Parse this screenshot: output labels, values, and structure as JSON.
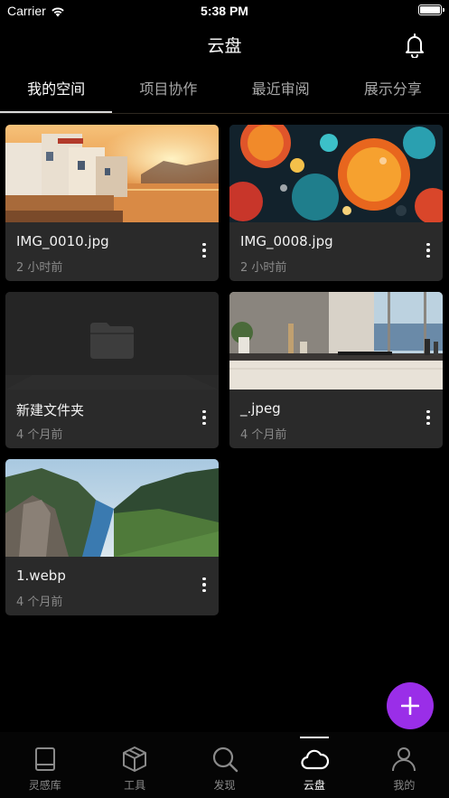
{
  "status_bar": {
    "carrier": "Carrier",
    "time": "5:38 PM",
    "battery_level": 1.0
  },
  "header": {
    "title": "云盘"
  },
  "tabs": [
    {
      "label": "我的空间",
      "active": true
    },
    {
      "label": "项目协作",
      "active": false
    },
    {
      "label": "最近审阅",
      "active": false
    },
    {
      "label": "展示分享",
      "active": false
    }
  ],
  "files": [
    {
      "name": "IMG_0010.jpg",
      "time": "2 小时前",
      "kind": "image"
    },
    {
      "name": "IMG_0008.jpg",
      "time": "2 小时前",
      "kind": "image"
    },
    {
      "name": "新建文件夹",
      "time": "4 个月前",
      "kind": "folder"
    },
    {
      "name": "_.jpeg",
      "time": "4 个月前",
      "kind": "image"
    },
    {
      "name": "1.webp",
      "time": "4 个月前",
      "kind": "image"
    }
  ],
  "tabbar": [
    {
      "label": "灵感库",
      "icon": "book-icon",
      "active": false
    },
    {
      "label": "工具",
      "icon": "cube-icon",
      "active": false
    },
    {
      "label": "发现",
      "icon": "search-icon",
      "active": false
    },
    {
      "label": "云盘",
      "icon": "cloud-icon",
      "active": true
    },
    {
      "label": "我的",
      "icon": "person-icon",
      "active": false
    }
  ],
  "colors": {
    "accent": "#9a2ee8",
    "card_bg": "#2a2a2a",
    "background": "#000000"
  }
}
